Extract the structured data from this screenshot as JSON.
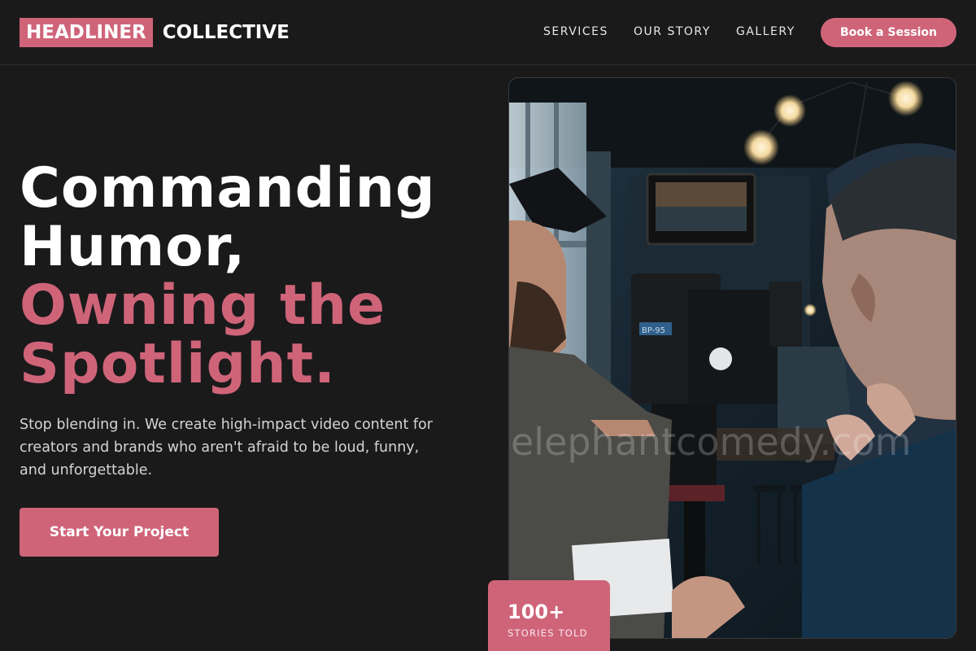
{
  "brand": {
    "highlight": "HEADLINER",
    "rest": "COLLECTIVE"
  },
  "nav": {
    "links": [
      "SERVICES",
      "OUR STORY",
      "GALLERY"
    ],
    "cta": "Book a Session"
  },
  "hero": {
    "title_line1": "Commanding",
    "title_line2": "Humor,",
    "title_accent1": "Owning the",
    "title_accent2": "Spotlight.",
    "subtitle": "Stop blending in. We create high-impact video content for creators and brands who aren't afraid to be loud, funny, and unforgettable.",
    "cta": "Start Your Project"
  },
  "photo": {
    "watermark": "elephantcomedy.com",
    "camera_label": "BP-95"
  },
  "stat": {
    "value": "100+",
    "label": "STORIES TOLD"
  },
  "colors": {
    "accent": "#cf6479",
    "background": "#1b1a1b"
  }
}
